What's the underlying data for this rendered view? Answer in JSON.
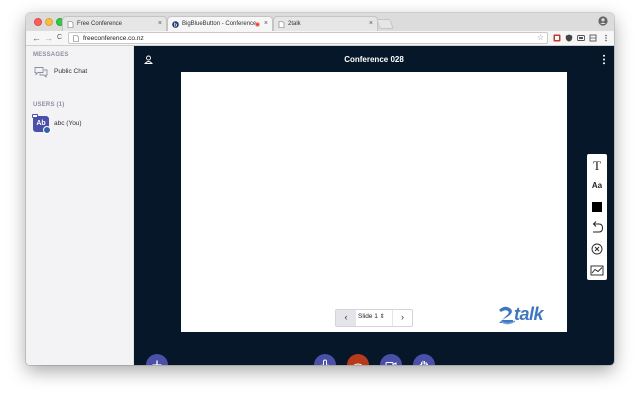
{
  "browser": {
    "tabs": [
      {
        "title": "Free Conference"
      },
      {
        "title": "BigBlueButton - Conference"
      },
      {
        "title": "2talk"
      }
    ],
    "address_bar": {
      "url": "freeconference.co.nz"
    },
    "nav": {
      "back": "←",
      "forward": "→",
      "reload": "C"
    },
    "close_glyph": "×"
  },
  "sidebar": {
    "messages_title": "MESSAGES",
    "public_chat": "Public Chat",
    "users_title": "USERS (1)",
    "users": [
      {
        "initials": "Ab",
        "name": "abc (You)"
      }
    ]
  },
  "main": {
    "title": "Conference 028",
    "slide_controls": {
      "prev": "‹",
      "current": "Slide 1",
      "select_arrow": "⇕",
      "next": "›"
    },
    "logo": {
      "text": "talk"
    }
  },
  "whiteboard_tools": [
    {
      "name": "text-tool-icon",
      "glyph": "T"
    },
    {
      "name": "font-size-icon",
      "glyph": "Aa"
    },
    {
      "name": "color-swatch-icon",
      "glyph": ""
    },
    {
      "name": "undo-icon",
      "glyph": ""
    },
    {
      "name": "clear-icon",
      "glyph": ""
    },
    {
      "name": "multi-user-icon",
      "glyph": ""
    }
  ],
  "colors": {
    "main_bg": "#06172a",
    "accent": "#4a4fa8",
    "hangup": "#b83a1c",
    "logo_blue": "#3f77bf"
  }
}
